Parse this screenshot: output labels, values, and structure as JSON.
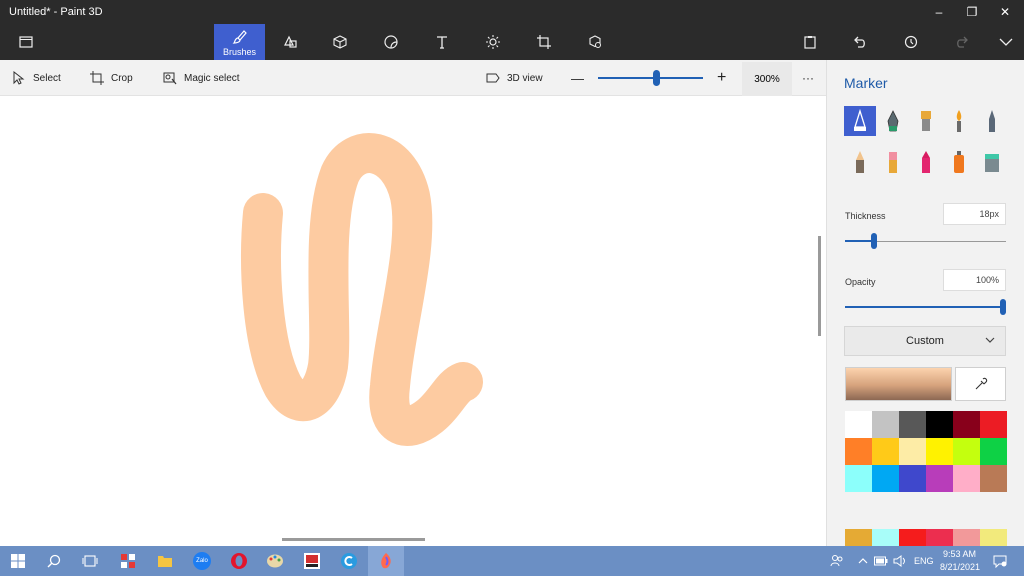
{
  "window": {
    "title": "Untitled* - Paint 3D",
    "minimize": "–",
    "maximize": "❐",
    "close": "✕"
  },
  "ribbon": {
    "active_label": "Brushes",
    "tools": [
      "menu",
      "brushes",
      "2d-shapes",
      "3d-shapes",
      "stickers",
      "text",
      "effects",
      "canvas",
      "3d-library"
    ],
    "actions": [
      "paste",
      "undo",
      "history",
      "redo",
      "expand"
    ]
  },
  "toolbar": {
    "select": "Select",
    "crop": "Crop",
    "magic_select": "Magic select",
    "view3d": "3D view",
    "zoom_out": "—",
    "zoom_in": "+",
    "zoom": "300%",
    "more": "···",
    "zoom_fraction": 0.55
  },
  "panel": {
    "title": "Marker",
    "brushes": [
      "marker",
      "calligraphy-pen",
      "oil-brush",
      "watercolor",
      "pixel-pen",
      "pencil",
      "eraser",
      "crayon",
      "spray-can",
      "fill"
    ],
    "thickness_label": "Thickness",
    "thickness_value": "18px",
    "thickness_fraction": 0.18,
    "opacity_label": "Opacity",
    "opacity_value": "100%",
    "opacity_fraction": 1.0,
    "color_mode": "Custom",
    "palette": [
      "#ffffff",
      "#c3c3c3",
      "#585858",
      "#000000",
      "#88001b",
      "#ec1c24",
      "#ff7f27",
      "#ffca18",
      "#fdeca6",
      "#fff200",
      "#c4ff0e",
      "#0ed145",
      "#8cfffb",
      "#00a8f3",
      "#3f48cc",
      "#b83dba",
      "#ffaec8",
      "#b97a56",
      "#e5aa34",
      "#a8fdf9",
      "#f51c1c",
      "#ec2e4f",
      "#f2999a",
      "#f2ea7c"
    ],
    "stroke_color": "#fdcba1"
  },
  "taskbar": {
    "time": "9:53 AM",
    "date": "8/21/2021",
    "lang": "ENG",
    "app_zalo": "Zalo"
  }
}
